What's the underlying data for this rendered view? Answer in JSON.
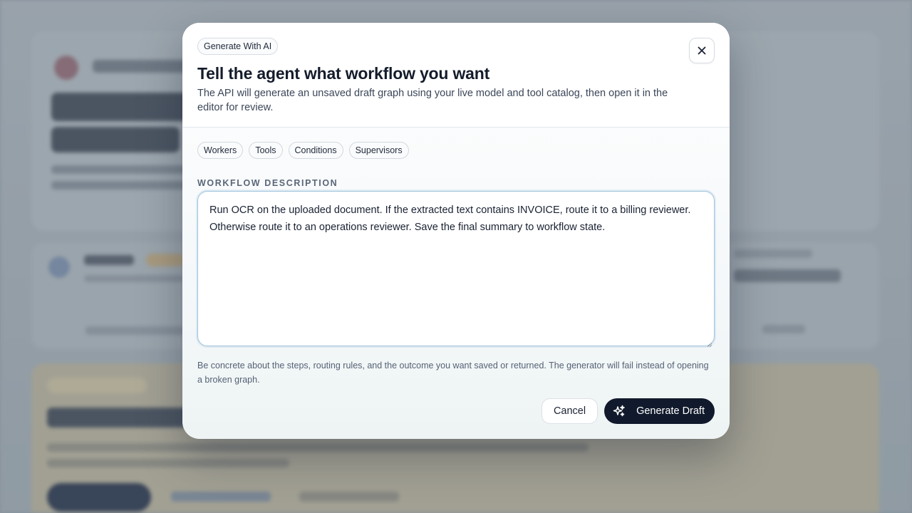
{
  "modal": {
    "eyebrow": "Generate With AI",
    "title": "Tell the agent what workflow you want",
    "subtitle": "The API will generate an unsaved draft graph using your live model and tool catalog, then open it in the editor for review.",
    "close_icon": "close-icon"
  },
  "chips": [
    {
      "label": "Workers"
    },
    {
      "label": "Tools"
    },
    {
      "label": "Conditions"
    },
    {
      "label": "Supervisors"
    }
  ],
  "field": {
    "label": "WORKFLOW DESCRIPTION",
    "value": "Run OCR on the uploaded document. If the extracted text contains INVOICE, route it to a billing reviewer. Otherwise route it to an operations reviewer. Save the final summary to workflow state.",
    "helper": "Be concrete about the steps, routing rules, and the outcome you want saved or returned. The generator will fail instead of opening a broken graph."
  },
  "actions": {
    "cancel_label": "Cancel",
    "generate_label": "Generate Draft",
    "generate_icon": "sparkles-icon"
  },
  "colors": {
    "primary": "#111a2c",
    "focus_border": "#9fc3dc",
    "text": "#141c2b",
    "muted": "#566275"
  }
}
